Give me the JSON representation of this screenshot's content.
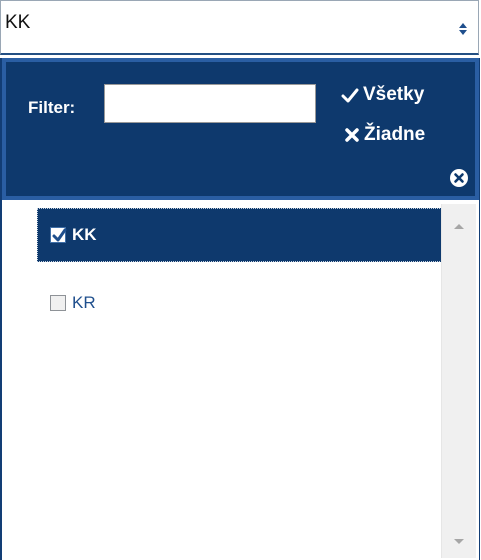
{
  "select": {
    "value": "KK"
  },
  "filter": {
    "label": "Filter:",
    "value": "",
    "placeholder": ""
  },
  "actions": {
    "select_all": "Všetky",
    "select_none": "Žiadne"
  },
  "items": [
    {
      "label": "KK",
      "checked": true
    },
    {
      "label": "KR",
      "checked": false
    }
  ],
  "colors": {
    "header_bg": "#0e396d",
    "header_border": "#2a5ea3",
    "link_text": "#1f4f8d"
  },
  "icons": {
    "select_arrows": "sort-arrows-icon",
    "all": "check-icon",
    "none": "x-icon",
    "close": "close-circle-icon"
  }
}
